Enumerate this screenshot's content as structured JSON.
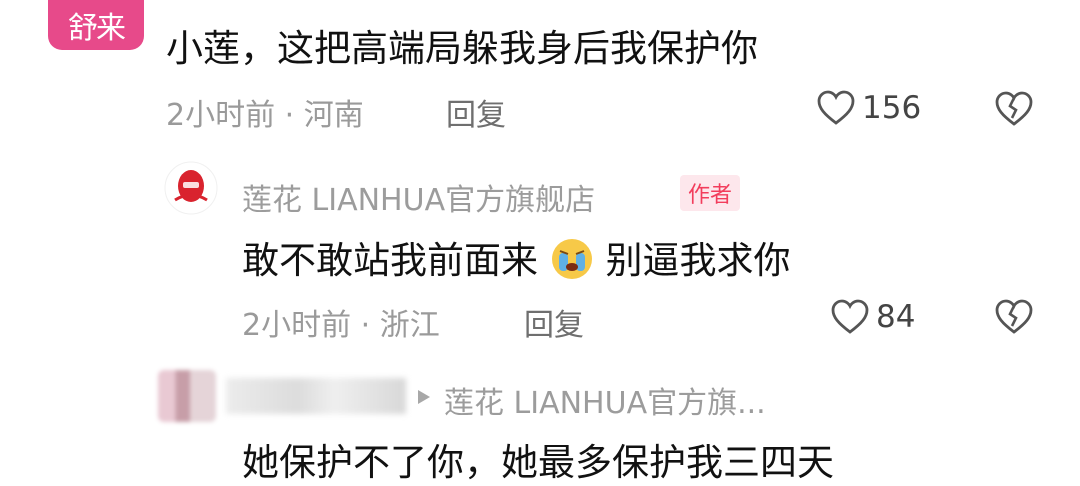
{
  "comment1": {
    "avatar_text": "舒来",
    "text": "小莲，这把高端局躲我身后我保护你",
    "time": "2小时前",
    "location": "河南",
    "reply_label": "回复",
    "likes": "156"
  },
  "reply1": {
    "author": "莲花 LIANHUA官方旗舰店",
    "badge": "作者",
    "text_a": "敢不敢站我前面来",
    "text_b": "别逼我求你",
    "time": "2小时前",
    "location": "浙江",
    "reply_label": "回复",
    "likes": "84"
  },
  "reply2": {
    "reply_to": "莲花 LIANHUA官方旗...",
    "text": "她保护不了你，她最多保护我三四天"
  },
  "colors": {
    "accent_pink": "#e74a8a",
    "badge_red": "#f23d5c",
    "meta_gray": "#9a9a9a"
  }
}
